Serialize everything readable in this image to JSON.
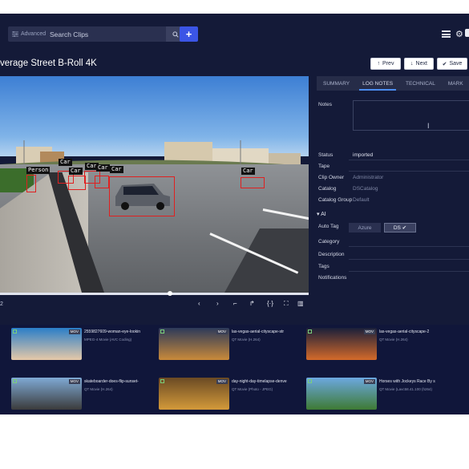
{
  "header": {
    "advanced_label": "Advanced",
    "search_placeholder": "Search Clips",
    "add_label": "+"
  },
  "title": {
    "text": "verage Street B-Roll 4K",
    "prev_label": "Prev",
    "next_label": "Next",
    "save_label": "Save"
  },
  "video": {
    "detections": [
      {
        "label": "Person"
      },
      {
        "label": "Car"
      },
      {
        "label": "Car"
      },
      {
        "label": "Car"
      },
      {
        "label": "Car"
      },
      {
        "label": "Car"
      },
      {
        "label": "Car"
      }
    ],
    "time": "2",
    "progress": 0.55
  },
  "panel": {
    "tabs": [
      "SUMMARY",
      "LOG NOTES",
      "TECHNICAL",
      "MARK"
    ],
    "active_tab": "LOG NOTES",
    "fields": {
      "notes": "Notes",
      "status_label": "Status",
      "status_value": "imported",
      "tape_label": "Tape",
      "owner_label": "Clip Owner",
      "owner_value": "Administrator",
      "catalog_label": "Catalog",
      "catalog_value": "DSCatalog",
      "group_label": "Catalog Group",
      "group_value": "Default"
    },
    "ai": {
      "heading": "AI",
      "autotag_label": "Auto Tag",
      "azure_label": "Azure",
      "ds_label": "DS",
      "category_label": "Category",
      "description_label": "Description",
      "tags_label": "Tags",
      "notifications_label": "Notifications"
    }
  },
  "thumbnails": [
    {
      "title": "2559827609-woman-eye-lookin",
      "subtitle": "MPEG-4 Movie (AVC Coding)",
      "format": "MOV",
      "colors": [
        "#2a7ec8",
        "#e6c9a8"
      ]
    },
    {
      "title": "las-vegas-aerial-cityscape-str",
      "subtitle": "QT Movie (H.264)",
      "format": "MOV",
      "colors": [
        "#2c3a5a",
        "#c98a3a"
      ]
    },
    {
      "title": "las-vegas-aerial-cityscape-2",
      "subtitle": "QT Movie (H.264)",
      "format": "MOV",
      "colors": [
        "#1a1f3a",
        "#d46a2a"
      ]
    },
    {
      "title": "skateboarder-does-flip-sunset-",
      "subtitle": "QT Movie (H.264)",
      "format": "MOV",
      "colors": [
        "#7fa9d4",
        "#3b3b3b"
      ]
    },
    {
      "title": "day-night-day-timelapse-denve",
      "subtitle": "QT Movie (Photo - JPEG)",
      "format": "MOV",
      "colors": [
        "#6a4a24",
        "#d49a3a"
      ]
    },
    {
      "title": "Horses with Jockeys Race By s",
      "subtitle": "QT Movie (Lavc58.41.100 (h264)",
      "format": "MOV",
      "colors": [
        "#6ca8e0",
        "#3e7a34"
      ]
    }
  ]
}
